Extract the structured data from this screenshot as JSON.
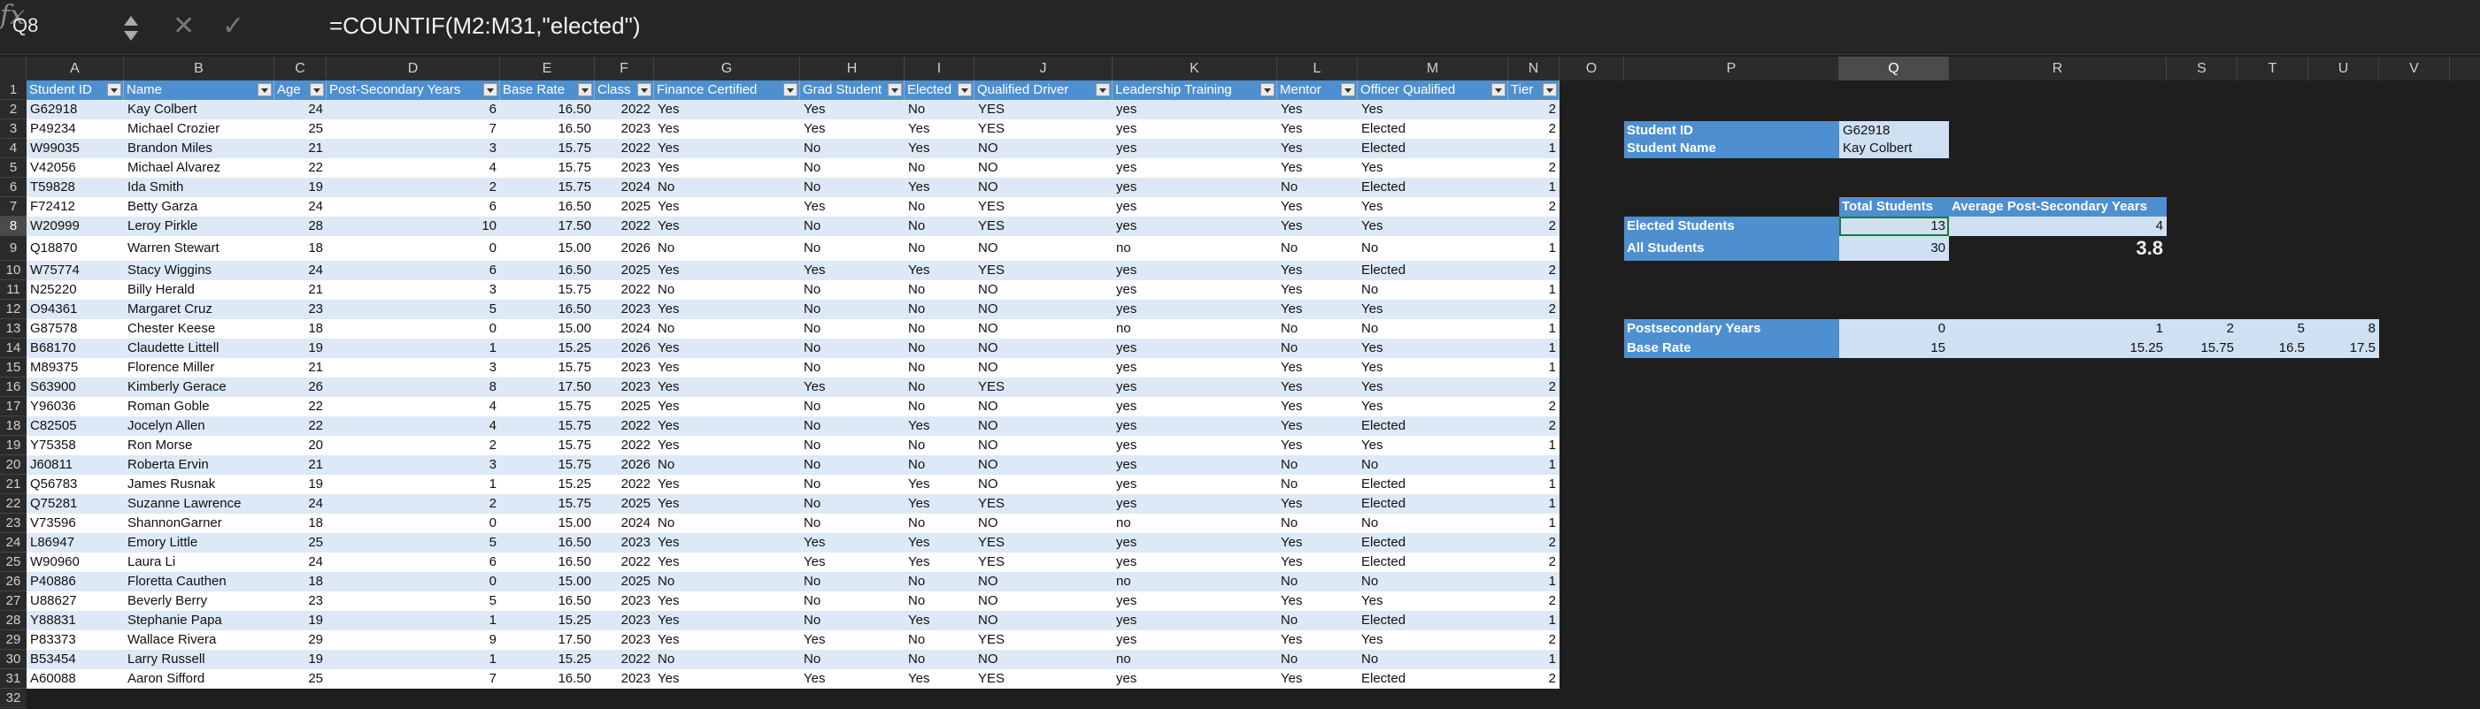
{
  "formula_bar": {
    "name_box": "Q8",
    "formula": "=COUNTIF(M2:M31,\"elected\")",
    "cancel_icon": "✕",
    "enter_icon": "✓",
    "fx_icon": "fx"
  },
  "columns": [
    "A",
    "B",
    "C",
    "D",
    "E",
    "F",
    "G",
    "H",
    "I",
    "J",
    "K",
    "L",
    "M",
    "N",
    "O",
    "P",
    "Q",
    "R",
    "S",
    "T",
    "U",
    "V"
  ],
  "selected_column": "Q",
  "selected_row": 8,
  "table": {
    "headers": [
      "Student ID",
      "Name",
      "Age",
      "Post-Secondary Years",
      "Base Rate",
      "Class",
      "Finance Certified",
      "Grad Student",
      "Elected",
      "Qualified Driver",
      "Leadership Training",
      "Mentor",
      "Officer Qualified",
      "Tier"
    ],
    "rows": [
      [
        "G62918",
        "Kay Colbert",
        "24",
        "6",
        "16.50",
        "2022",
        "Yes",
        "Yes",
        "No",
        "YES",
        "yes",
        "Yes",
        "Yes",
        "2"
      ],
      [
        "P49234",
        "Michael Crozier",
        "25",
        "7",
        "16.50",
        "2023",
        "Yes",
        "Yes",
        "Yes",
        "YES",
        "yes",
        "Yes",
        "Elected",
        "2"
      ],
      [
        "W99035",
        "Brandon Miles",
        "21",
        "3",
        "15.75",
        "2022",
        "Yes",
        "No",
        "Yes",
        "NO",
        "yes",
        "Yes",
        "Elected",
        "1"
      ],
      [
        "V42056",
        "Michael Alvarez",
        "22",
        "4",
        "15.75",
        "2023",
        "Yes",
        "No",
        "No",
        "NO",
        "yes",
        "Yes",
        "Yes",
        "2"
      ],
      [
        "T59828",
        "Ida Smith",
        "19",
        "2",
        "15.75",
        "2024",
        "No",
        "No",
        "Yes",
        "NO",
        "yes",
        "No",
        "Elected",
        "1"
      ],
      [
        "F72412",
        "Betty Garza",
        "24",
        "6",
        "16.50",
        "2025",
        "Yes",
        "Yes",
        "No",
        "YES",
        "yes",
        "Yes",
        "Yes",
        "2"
      ],
      [
        "W20999",
        "Leroy Pirkle",
        "28",
        "10",
        "17.50",
        "2022",
        "Yes",
        "No",
        "No",
        "YES",
        "yes",
        "Yes",
        "Yes",
        "2"
      ],
      [
        "Q18870",
        "Warren Stewart",
        "18",
        "0",
        "15.00",
        "2026",
        "No",
        "No",
        "No",
        "NO",
        "no",
        "No",
        "No",
        "1"
      ],
      [
        "W75774",
        "Stacy Wiggins",
        "24",
        "6",
        "16.50",
        "2025",
        "Yes",
        "Yes",
        "Yes",
        "YES",
        "yes",
        "Yes",
        "Elected",
        "2"
      ],
      [
        "N25220",
        "Billy Herald",
        "21",
        "3",
        "15.75",
        "2022",
        "No",
        "No",
        "No",
        "NO",
        "yes",
        "Yes",
        "No",
        "1"
      ],
      [
        "O94361",
        "Margaret Cruz",
        "23",
        "5",
        "16.50",
        "2023",
        "Yes",
        "No",
        "No",
        "NO",
        "yes",
        "Yes",
        "Yes",
        "2"
      ],
      [
        "G87578",
        "Chester Keese",
        "18",
        "0",
        "15.00",
        "2024",
        "No",
        "No",
        "No",
        "NO",
        "no",
        "No",
        "No",
        "1"
      ],
      [
        "B68170",
        "Claudette Littell",
        "19",
        "1",
        "15.25",
        "2026",
        "Yes",
        "No",
        "No",
        "NO",
        "yes",
        "No",
        "Yes",
        "1"
      ],
      [
        "M89375",
        "Florence Miller",
        "21",
        "3",
        "15.75",
        "2023",
        "Yes",
        "No",
        "No",
        "NO",
        "yes",
        "Yes",
        "Yes",
        "1"
      ],
      [
        "S63900",
        "Kimberly Gerace",
        "26",
        "8",
        "17.50",
        "2023",
        "Yes",
        "Yes",
        "No",
        "YES",
        "yes",
        "Yes",
        "Yes",
        "2"
      ],
      [
        "Y96036",
        "Roman Goble",
        "22",
        "4",
        "15.75",
        "2025",
        "Yes",
        "No",
        "No",
        "NO",
        "yes",
        "Yes",
        "Yes",
        "2"
      ],
      [
        "C82505",
        "Jocelyn Allen",
        "22",
        "4",
        "15.75",
        "2022",
        "Yes",
        "No",
        "Yes",
        "NO",
        "yes",
        "Yes",
        "Elected",
        "2"
      ],
      [
        "Y75358",
        "Ron Morse",
        "20",
        "2",
        "15.75",
        "2022",
        "Yes",
        "No",
        "No",
        "NO",
        "yes",
        "Yes",
        "Yes",
        "1"
      ],
      [
        "J60811",
        "Roberta Ervin",
        "21",
        "3",
        "15.75",
        "2026",
        "No",
        "No",
        "No",
        "NO",
        "yes",
        "No",
        "No",
        "1"
      ],
      [
        "Q56783",
        "James Rusnak",
        "19",
        "1",
        "15.25",
        "2022",
        "Yes",
        "No",
        "Yes",
        "NO",
        "yes",
        "No",
        "Elected",
        "1"
      ],
      [
        "Q75281",
        "Suzanne Lawrence",
        "24",
        "2",
        "15.75",
        "2025",
        "Yes",
        "No",
        "Yes",
        "YES",
        "yes",
        "Yes",
        "Elected",
        "1"
      ],
      [
        "V73596",
        "ShannonGarner",
        "18",
        "0",
        "15.00",
        "2024",
        "No",
        "No",
        "No",
        "NO",
        "no",
        "No",
        "No",
        "1"
      ],
      [
        "L86947",
        "Emory Little",
        "25",
        "5",
        "16.50",
        "2023",
        "Yes",
        "Yes",
        "Yes",
        "YES",
        "yes",
        "Yes",
        "Elected",
        "2"
      ],
      [
        "W90960",
        "Laura Li",
        "24",
        "6",
        "16.50",
        "2022",
        "Yes",
        "Yes",
        "Yes",
        "YES",
        "yes",
        "Yes",
        "Elected",
        "2"
      ],
      [
        "P40886",
        "Floretta Cauthen",
        "18",
        "0",
        "15.00",
        "2025",
        "No",
        "No",
        "No",
        "NO",
        "no",
        "No",
        "No",
        "1"
      ],
      [
        "U88627",
        "Beverly Berry",
        "23",
        "5",
        "16.50",
        "2023",
        "Yes",
        "No",
        "No",
        "NO",
        "yes",
        "Yes",
        "Yes",
        "2"
      ],
      [
        "Y88831",
        "Stephanie Papa",
        "19",
        "1",
        "15.25",
        "2023",
        "Yes",
        "No",
        "Yes",
        "NO",
        "yes",
        "No",
        "Elected",
        "1"
      ],
      [
        "P83373",
        "Wallace Rivera",
        "29",
        "9",
        "17.50",
        "2023",
        "Yes",
        "Yes",
        "No",
        "YES",
        "yes",
        "Yes",
        "Yes",
        "2"
      ],
      [
        "B53454",
        "Larry Russell",
        "19",
        "1",
        "15.25",
        "2022",
        "No",
        "No",
        "No",
        "NO",
        "no",
        "No",
        "No",
        "1"
      ],
      [
        "A60088",
        "Aaron Sifford",
        "25",
        "7",
        "16.50",
        "2023",
        "Yes",
        "Yes",
        "Yes",
        "YES",
        "yes",
        "Yes",
        "Elected",
        "2"
      ]
    ]
  },
  "lookup": {
    "student_id_label": "Student ID",
    "student_id_value": "G62918",
    "student_name_label": "Student Name",
    "student_name_value": "Kay Colbert"
  },
  "summary": {
    "total_students_header": "Total Students",
    "avg_years_header": "Average Post-Secondary Years",
    "elected_label": "Elected Students",
    "elected_total": "13",
    "elected_avg": "4",
    "all_label": "All Students",
    "all_total": "30",
    "all_avg": "3.8"
  },
  "rate_table": {
    "years_label": "Postsecondary Years",
    "rate_label": "Base Rate",
    "years": [
      "0",
      "1",
      "2",
      "5",
      "8"
    ],
    "rates": [
      "15",
      "15.25",
      "15.75",
      "16.5",
      "17.5"
    ]
  }
}
